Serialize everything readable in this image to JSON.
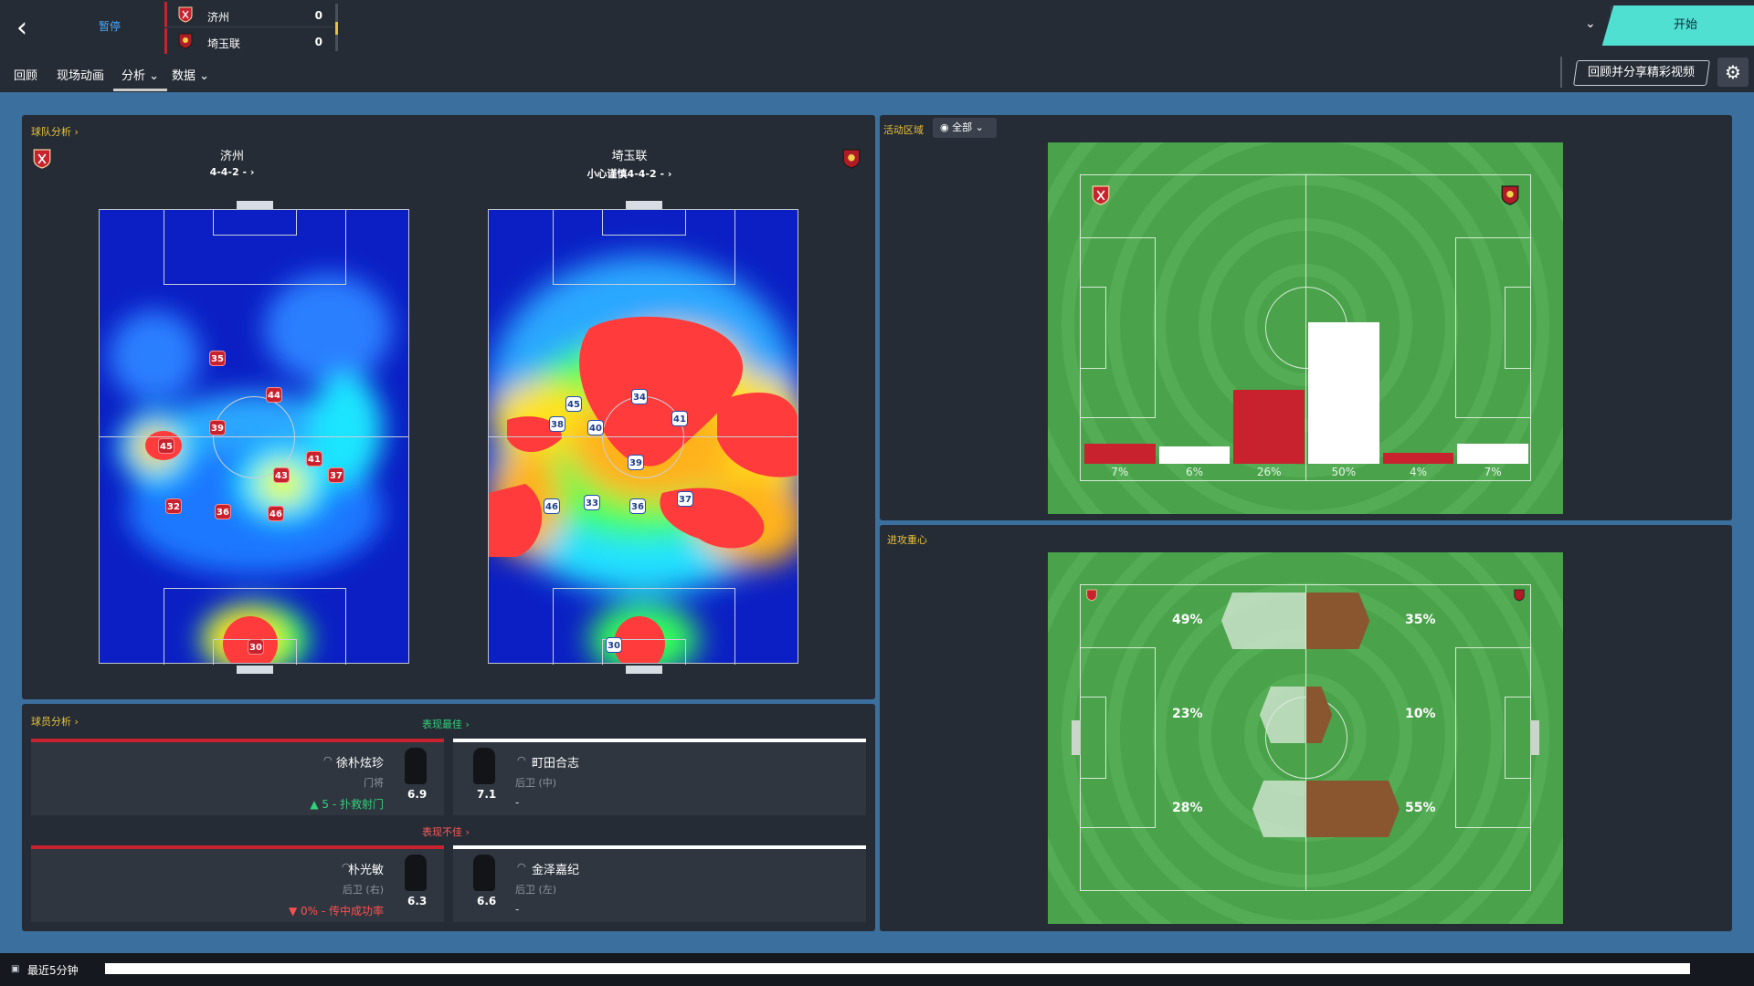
{
  "header": {
    "status": "暂停",
    "home": {
      "name": "济州",
      "score": "0"
    },
    "away": {
      "name": "埼玉联",
      "score": "0"
    },
    "menu": [
      "回顾",
      "现场动画",
      "分析",
      "数据"
    ],
    "start_label": "开始",
    "replay_label": "回顾并分享精彩视频"
  },
  "team_analysis": {
    "title": "球队分析",
    "home": {
      "name": "济州",
      "formation": "4-4-2 -"
    },
    "away": {
      "name": "埼玉联",
      "formation": "小心谨慎4-4-2 -"
    },
    "home_numbers": [
      "35",
      "44",
      "39",
      "45",
      "41",
      "43",
      "37",
      "32",
      "36",
      "46",
      "30"
    ],
    "away_numbers": [
      "45",
      "34",
      "38",
      "40",
      "41",
      "39",
      "46",
      "33",
      "36",
      "37",
      "30"
    ]
  },
  "activity": {
    "title": "活动区域",
    "filter": "全部",
    "bars": [
      {
        "team": "home",
        "value": 7,
        "label": "7%"
      },
      {
        "team": "away",
        "value": 6,
        "label": "6%"
      },
      {
        "team": "home",
        "value": 26,
        "label": "26%"
      },
      {
        "team": "away",
        "value": 50,
        "label": "50%"
      },
      {
        "team": "home",
        "value": 4,
        "label": "4%"
      },
      {
        "team": "away",
        "value": 7,
        "label": "7%"
      }
    ]
  },
  "attack": {
    "title": "进攻重心",
    "rows": [
      {
        "home": 49,
        "home_label": "49%",
        "away": 35,
        "away_label": "35%"
      },
      {
        "home": 23,
        "home_label": "23%",
        "away": 10,
        "away_label": "10%"
      },
      {
        "home": 28,
        "home_label": "28%",
        "away": 55,
        "away_label": "55%"
      }
    ]
  },
  "player_analysis": {
    "title": "球员分析",
    "best_label": "表现最佳",
    "worst_label": "表现不佳",
    "best_home": {
      "name": "徐朴炫珍",
      "pos": "门将",
      "rating": "6.9",
      "stat": "5 - 扑救射门"
    },
    "best_away": {
      "name": "町田合志",
      "pos": "后卫 (中)",
      "rating": "7.1",
      "stat": "-"
    },
    "worst_home": {
      "name": "朴光敏",
      "pos": "后卫 (右)",
      "rating": "6.3",
      "stat": "0% - 传中成功率"
    },
    "worst_away": {
      "name": "金泽嘉纪",
      "pos": "后卫 (左)",
      "rating": "6.6",
      "stat": "-"
    }
  },
  "bottom": {
    "label": "最近5分钟"
  },
  "colors": {
    "home": "#c8222f",
    "away": "#ffffff",
    "accent": "#e8c13a",
    "pitch": "#4aa24b",
    "start": "#4fe0d2"
  }
}
